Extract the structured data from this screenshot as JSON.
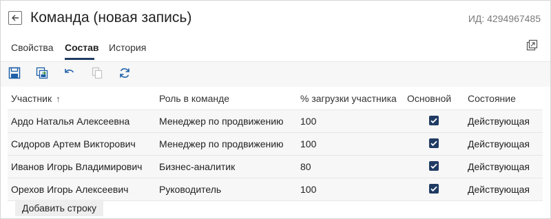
{
  "header": {
    "title": "Команда (новая запись)",
    "record_id": "ИД: 4294967485"
  },
  "tabs": [
    {
      "label": "Свойства",
      "active": false
    },
    {
      "label": "Состав",
      "active": true
    },
    {
      "label": "История",
      "active": false
    }
  ],
  "toolbar": {
    "icons": [
      "save-icon",
      "save-and-close-icon",
      "undo-icon",
      "copy-icon",
      "refresh-icon"
    ],
    "disabled": [
      "copy-icon"
    ]
  },
  "grid": {
    "columns": [
      "Участник",
      "Роль в команде",
      "% загрузки участника",
      "Основной",
      "Состояние"
    ],
    "sort_column": "Участник",
    "sort_indicator": "↑",
    "rows": [
      {
        "member": "Ардо Наталья Алексеевна",
        "role": "Менеджер по продвижению",
        "load": "100",
        "primary": true,
        "state": "Действующая"
      },
      {
        "member": "Сидоров Артем Викторович",
        "role": "Менеджер по продвижению",
        "load": "100",
        "primary": true,
        "state": "Действующая"
      },
      {
        "member": "Иванов Игорь Владимирович",
        "role": "Бизнес-аналитик",
        "load": "80",
        "primary": true,
        "state": "Действующая"
      },
      {
        "member": "Орехов Игорь Алексеевич",
        "role": "Руководитель",
        "load": "100",
        "primary": true,
        "state": "Действующая"
      }
    ]
  },
  "actions": {
    "add_row": "Добавить строку"
  },
  "colors": {
    "accent": "#1f3b63",
    "icon_blue": "#1e5fa8",
    "row_bg": "#f7f7f7"
  }
}
